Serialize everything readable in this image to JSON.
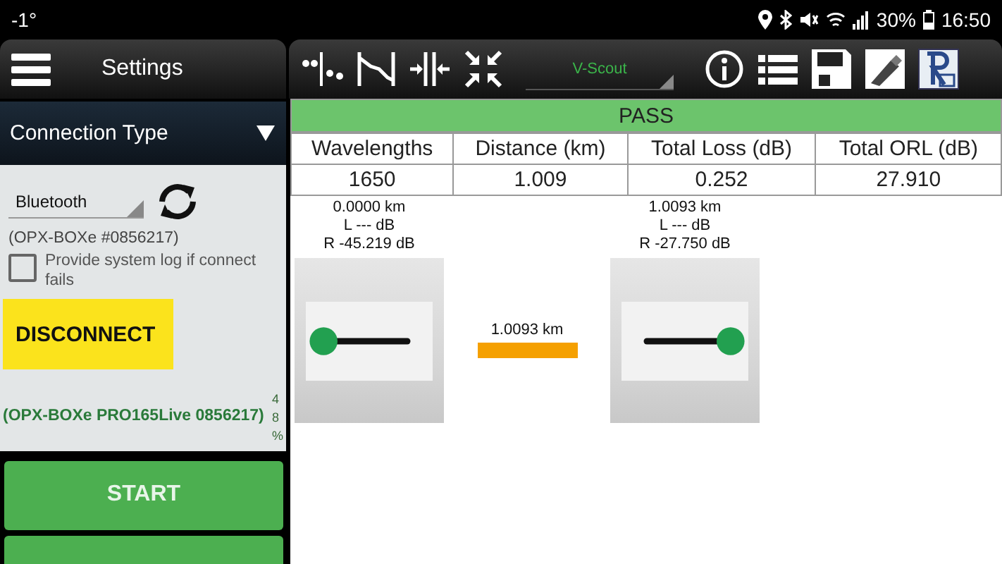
{
  "status_bar": {
    "temperature": "-1°",
    "battery": "30%",
    "time": "16:50"
  },
  "sidebar": {
    "title": "Settings",
    "section": {
      "title": "Connection Type",
      "expanded": true
    },
    "connection": {
      "value": "Bluetooth"
    },
    "device_id": "(OPX-BOXe #0856217)",
    "log_option": {
      "label": "Provide system log if connect fails",
      "checked": false
    },
    "disconnect_button": "DISCONNECT",
    "connected_device": "(OPX-BOXe PRO165Live 0856217)",
    "side_readout": [
      "4",
      "8",
      "%"
    ],
    "start_button": "START"
  },
  "toolbar": {
    "mode": "V-Scout"
  },
  "result": {
    "verdict": "PASS",
    "pass": true
  },
  "table": {
    "columns": [
      "Wavelengths",
      "Distance (km)",
      "Total Loss (dB)",
      "Total ORL (dB)"
    ],
    "rows": [
      [
        "1650",
        "1.009",
        "0.252",
        "27.910"
      ]
    ]
  },
  "events": [
    {
      "kind": "start",
      "distance": "0.0000 km",
      "loss": "L --- dB",
      "reflectance": "R -45.219 dB"
    },
    {
      "kind": "end",
      "distance": "1.0093 km",
      "loss": "L --- dB",
      "reflectance": "R -27.750 dB"
    }
  ],
  "span": {
    "label": "1.0093 km"
  }
}
